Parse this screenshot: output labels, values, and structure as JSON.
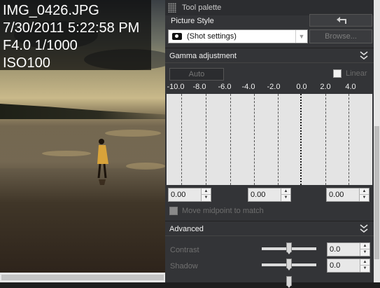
{
  "photo": {
    "exif": {
      "filename": "IMG_0426.JPG",
      "datetime": "7/30/2011 5:22:58 PM",
      "exposure": "F4.0 1/1000",
      "iso": "ISO100"
    }
  },
  "palette": {
    "title": "Tool palette",
    "picture_style": {
      "label": "Picture Style",
      "value": "(Shot settings)",
      "browse_label": "Browse..."
    },
    "gamma": {
      "label": "Gamma adjustment",
      "auto_label": "Auto",
      "linear_label": "Linear",
      "linear_checked": false,
      "ticks": [
        "-10.0",
        "-8.0",
        "-6.0",
        "-4.0",
        "-2.0",
        "0.0",
        "2.0",
        "4.0"
      ],
      "spin_left": "0.00",
      "spin_mid": "0.00",
      "spin_right": "0.00",
      "move_midpoint_label": "Move midpoint to match",
      "move_midpoint_checked": true
    },
    "advanced": {
      "label": "Advanced",
      "contrast_label": "Contrast",
      "contrast_value": "0.0",
      "shadow_label": "Shadow",
      "shadow_value": "0.0"
    }
  },
  "icons": [
    "grip-icon",
    "undo-icon",
    "camera-icon",
    "dropdown-arrow-icon",
    "double-chevron-down-icon",
    "spin-up-icon",
    "spin-down-icon"
  ]
}
